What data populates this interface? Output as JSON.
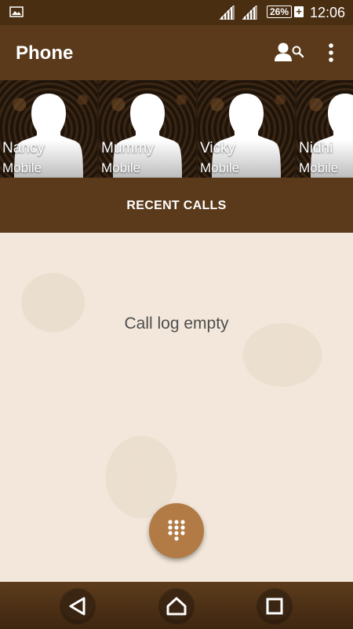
{
  "status_bar": {
    "time": "12:06",
    "battery_percent": "26%",
    "charging_symbol": "+"
  },
  "app_bar": {
    "title": "Phone",
    "actions": [
      {
        "icon": "contact-search-icon"
      },
      {
        "icon": "more-vert-icon"
      }
    ]
  },
  "favorites": [
    {
      "name": "Nancy",
      "type": "Mobile"
    },
    {
      "name": "Mummy",
      "type": "Mobile"
    },
    {
      "name": "Vicky",
      "type": "Mobile"
    },
    {
      "name": "Nidhi",
      "type": "Mobile"
    }
  ],
  "recent_calls": {
    "header": "RECENT CALLS",
    "empty_message": "Call log empty"
  },
  "fab": {
    "icon": "dialpad-icon"
  },
  "nav_bar": {
    "buttons": [
      {
        "icon": "back-icon"
      },
      {
        "icon": "home-icon"
      },
      {
        "icon": "recents-icon"
      }
    ]
  },
  "colors": {
    "bar_brown": "#5a3a1b",
    "status_brown": "#4a2e12",
    "fab_accent": "#b27a45",
    "background_cream": "#f2e7da"
  }
}
